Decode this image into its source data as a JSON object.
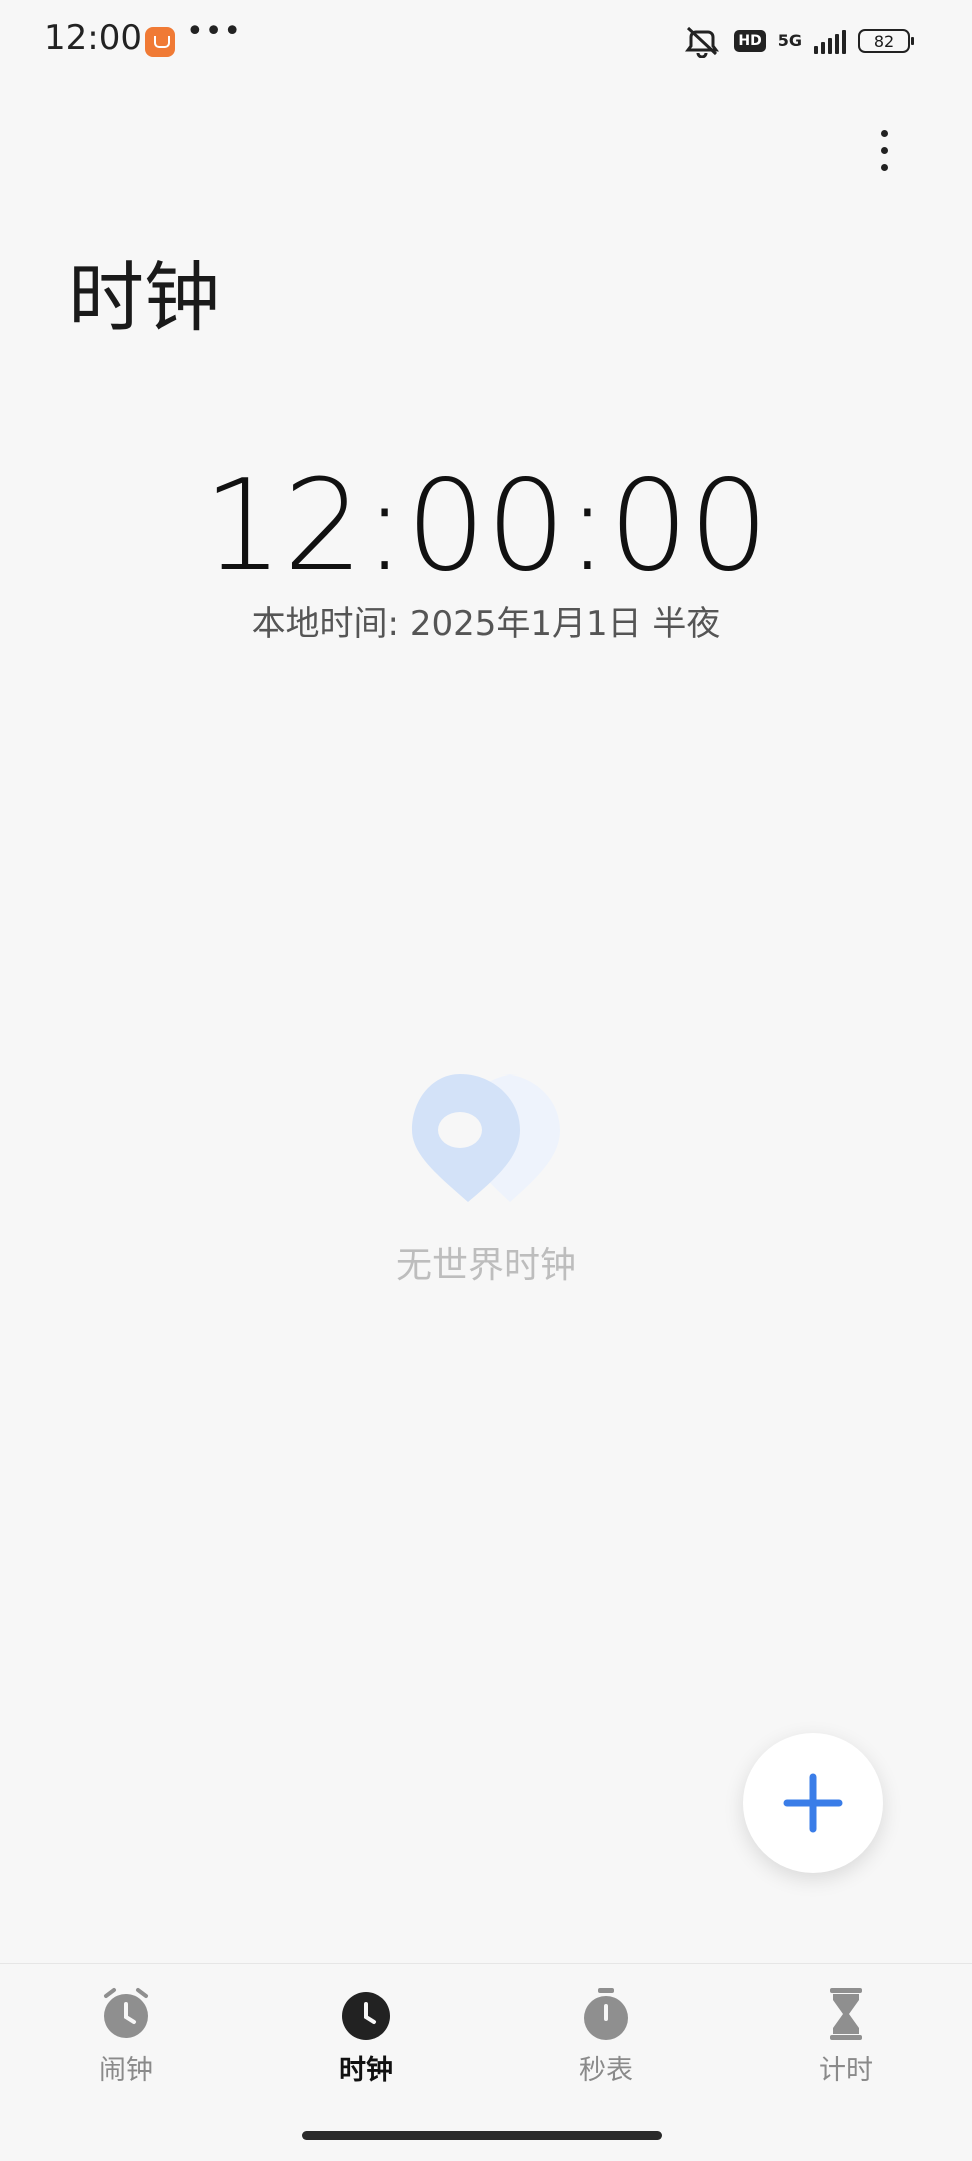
{
  "status_bar": {
    "time": "12:00",
    "more": "•••",
    "hd": "HD",
    "network": "5G",
    "battery": "82"
  },
  "header": {
    "title": "时钟"
  },
  "clock": {
    "time": "12:00:00",
    "date_label": "本地时间: 2025年1月1日 半夜"
  },
  "empty_state": {
    "text": "无世界时钟"
  },
  "bottom_nav": {
    "items": [
      {
        "label": "闹钟",
        "icon": "alarm-clock-icon",
        "active": false
      },
      {
        "label": "时钟",
        "icon": "clock-icon",
        "active": true
      },
      {
        "label": "秒表",
        "icon": "stopwatch-icon",
        "active": false
      },
      {
        "label": "计时",
        "icon": "hourglass-icon",
        "active": false
      }
    ]
  },
  "colors": {
    "accent": "#3a7de8",
    "background": "#f7f7f7",
    "active_icon": "#222222",
    "inactive_icon": "#8f8f8f"
  }
}
